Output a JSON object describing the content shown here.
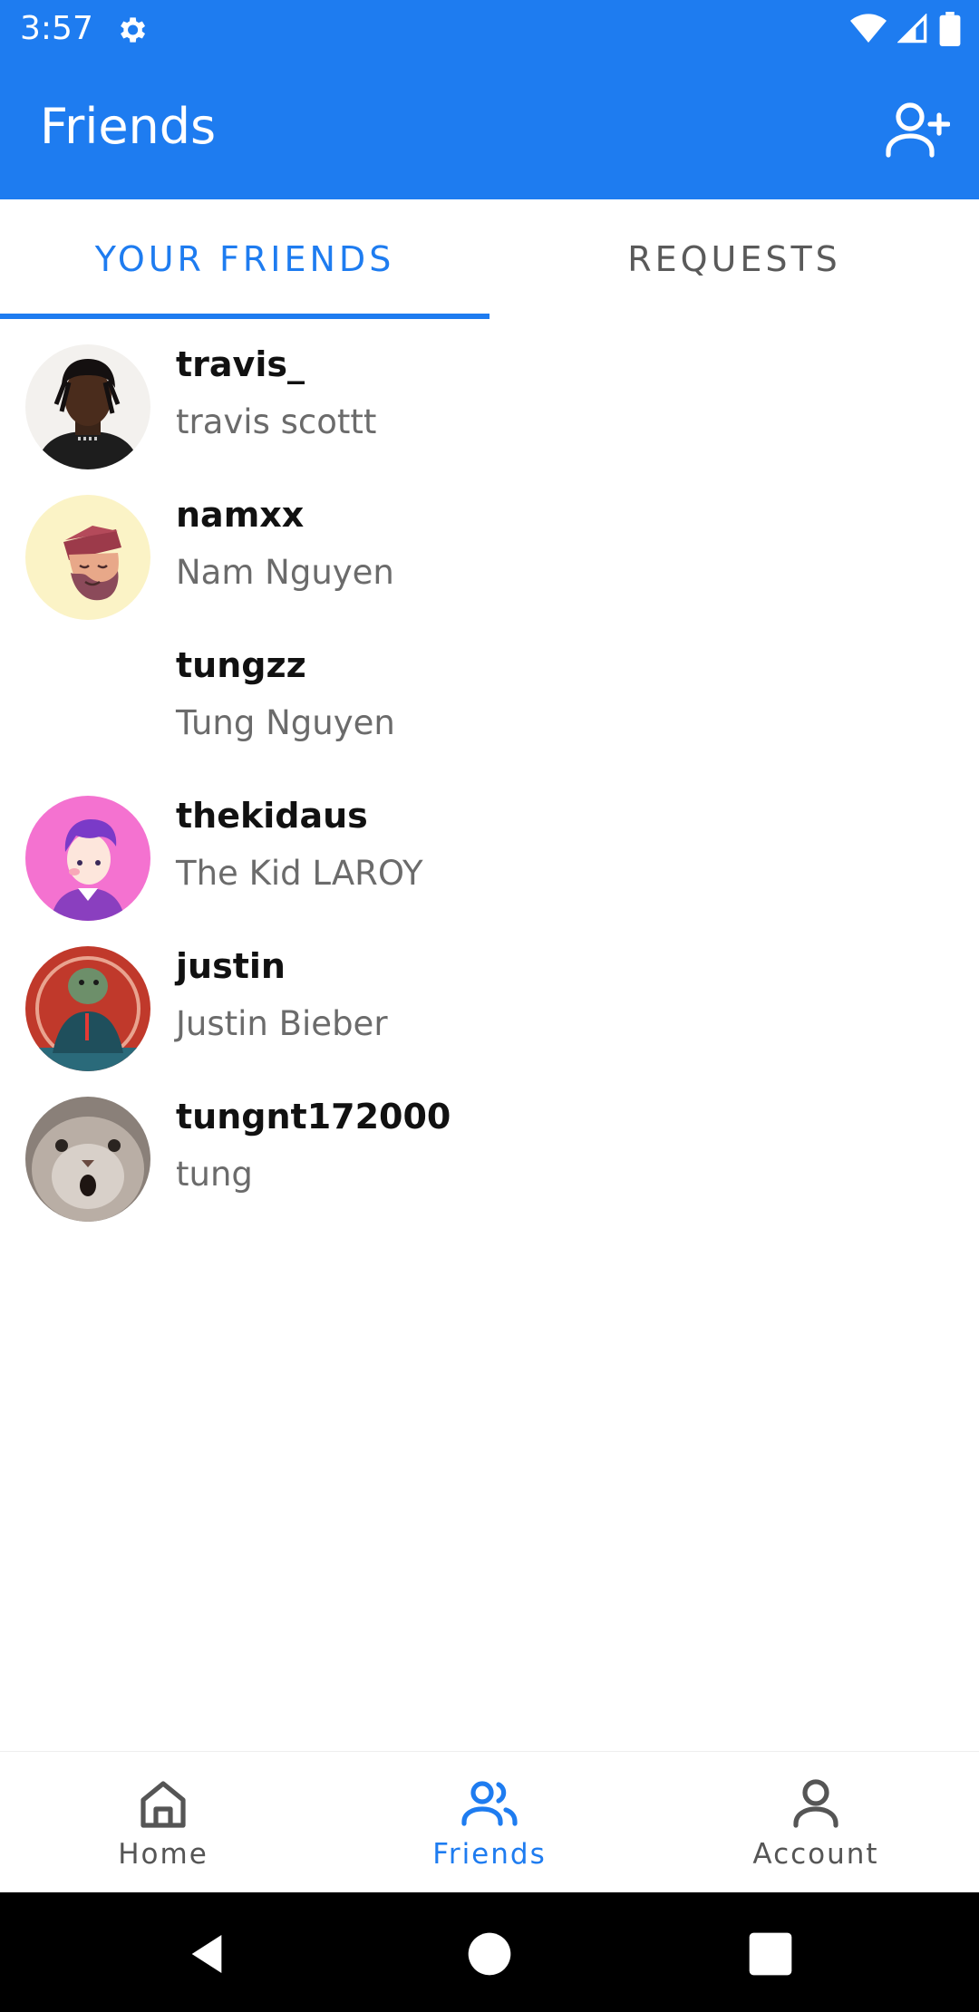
{
  "status_bar": {
    "time": "3:57",
    "icons": [
      "gear-icon",
      "wifi-icon",
      "signal-icon",
      "battery-icon"
    ]
  },
  "app_bar": {
    "title": "Friends",
    "action_icon": "add-person-icon"
  },
  "tabs": [
    {
      "label": "YOUR FRIENDS",
      "active": true
    },
    {
      "label": "REQUESTS",
      "active": false
    }
  ],
  "friends": [
    {
      "username": "travis_",
      "name": "travis scottt",
      "avatar": "photo"
    },
    {
      "username": "namxx",
      "name": "Nam Nguyen",
      "avatar": "cartoon-cap"
    },
    {
      "username": "tungzz",
      "name": "Tung Nguyen",
      "avatar": "none"
    },
    {
      "username": "thekidaus",
      "name": "The Kid LAROY",
      "avatar": "cartoon-purple"
    },
    {
      "username": "justin",
      "name": "Justin Bieber",
      "avatar": "cartoon-red"
    },
    {
      "username": "tungnt172000",
      "name": "tung",
      "avatar": "cat-photo"
    }
  ],
  "bottom_nav": [
    {
      "label": "Home",
      "icon": "home-icon",
      "active": false
    },
    {
      "label": "Friends",
      "icon": "friends-icon",
      "active": true
    },
    {
      "label": "Account",
      "icon": "account-icon",
      "active": false
    }
  ],
  "colors": {
    "primary": "#1e7cf0",
    "text_secondary": "#6b6b6b"
  }
}
